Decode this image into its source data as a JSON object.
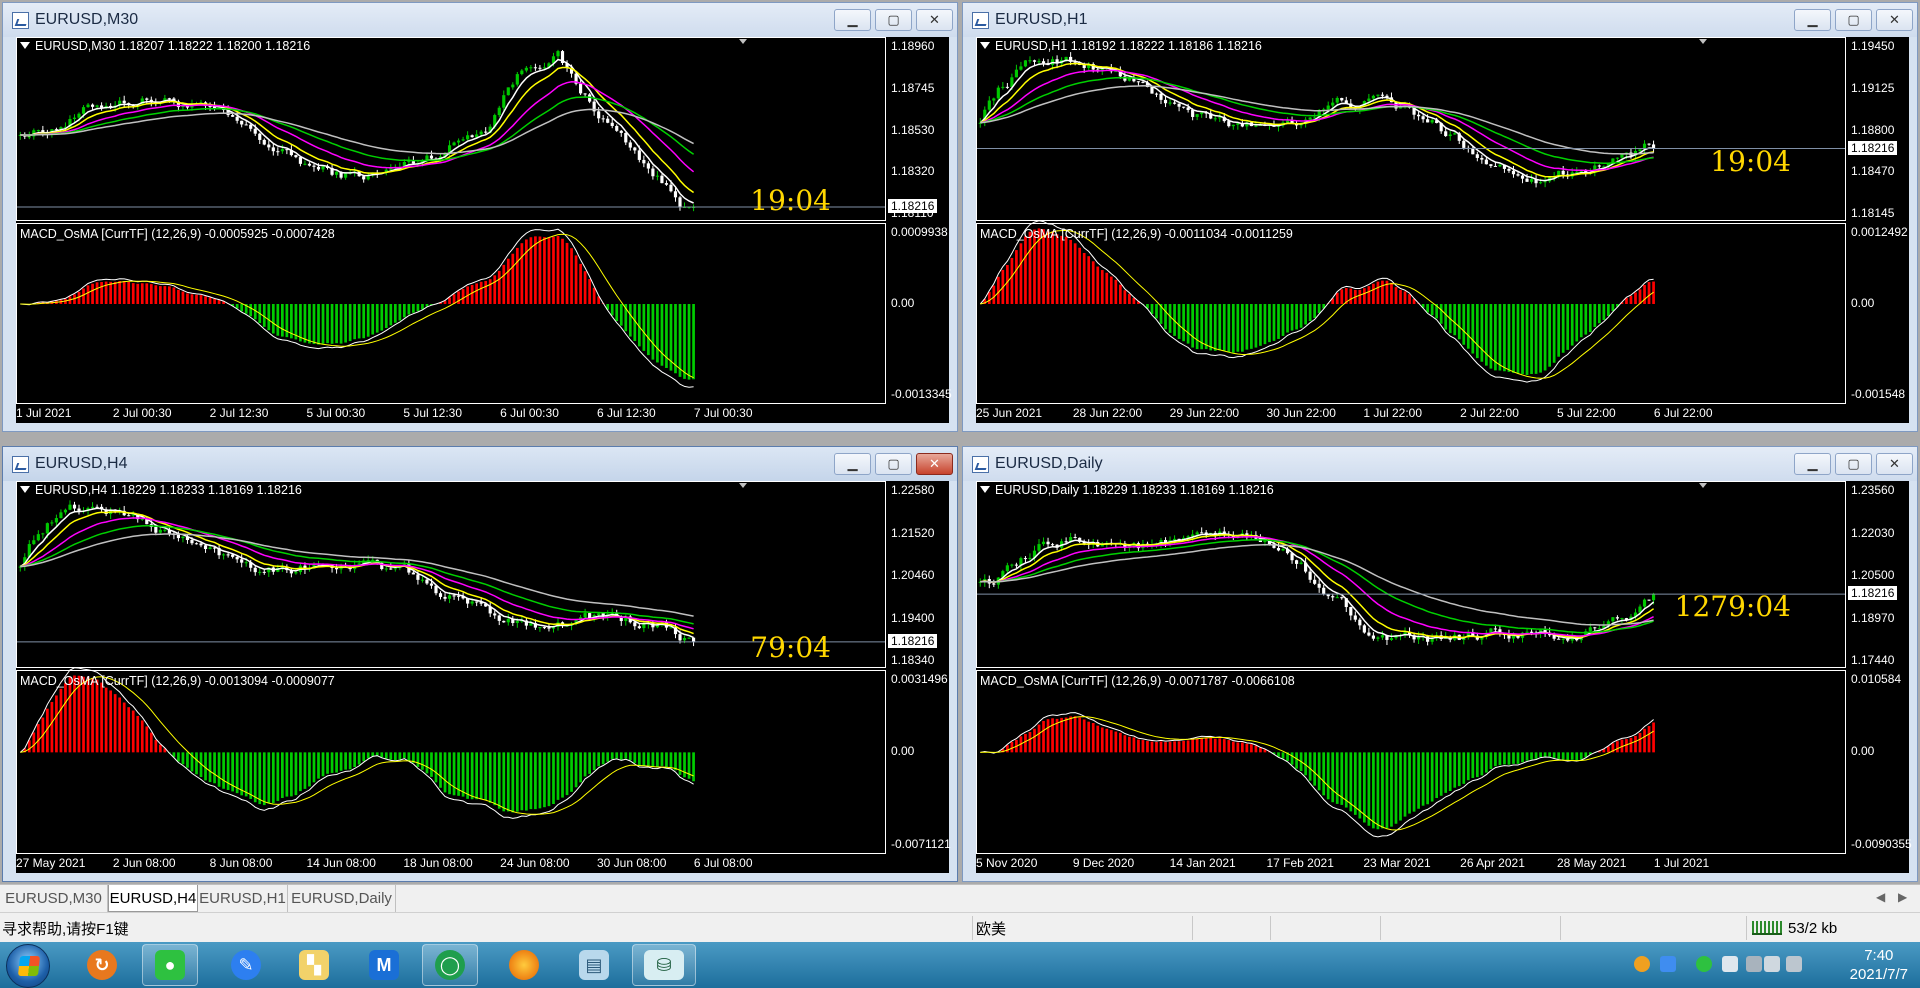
{
  "windows": [
    {
      "id": "m30",
      "title": "EURUSD,M30",
      "info": "EURUSD,M30  1.18207 1.18222 1.18200 1.18216",
      "prices": [
        "1.18960",
        "1.18745",
        "1.18530",
        "1.18320",
        "1.18110"
      ],
      "current_price": "1.18216",
      "timer": "19:04",
      "macd_info": "MACD_OsMA [CurrTF] (12,26,9) -0.0005925 -0.0007428",
      "macd_scale": [
        "0.0009938",
        "0.00",
        "-0.0013345"
      ],
      "dates": [
        "1 Jul 2021",
        "2 Jul 00:30",
        "2 Jul 12:30",
        "5 Jul 00:30",
        "5 Jul 12:30",
        "6 Jul 00:30",
        "6 Jul 12:30",
        "7 Jul 00:30"
      ]
    },
    {
      "id": "h1",
      "title": "EURUSD,H1",
      "info": "EURUSD,H1  1.18192 1.18222 1.18186 1.18216",
      "prices": [
        "1.19450",
        "1.19125",
        "1.18800",
        "1.18470",
        "1.18145"
      ],
      "current_price": "1.18216",
      "timer": "19:04",
      "macd_info": "MACD_OsMA [CurrTF] (12,26,9) -0.0011034 -0.0011259",
      "macd_scale": [
        "0.0012492",
        "0.00",
        "-0.001548"
      ],
      "dates": [
        "25 Jun 2021",
        "28 Jun 22:00",
        "29 Jun 22:00",
        "30 Jun 22:00",
        "1 Jul 22:00",
        "2 Jul 22:00",
        "5 Jul 22:00",
        "6 Jul 22:00"
      ]
    },
    {
      "id": "h4",
      "title": "EURUSD,H4",
      "info": "EURUSD,H4  1.18229 1.18233 1.18169 1.18216",
      "prices": [
        "1.22580",
        "1.21520",
        "1.20460",
        "1.19400",
        "1.18340"
      ],
      "current_price": "1.18216",
      "timer": "79:04",
      "macd_info": "MACD_OsMA [CurrTF] (12,26,9) -0.0013094 -0.0009077",
      "macd_scale": [
        "0.0031496",
        "0.00",
        "-0.0071121"
      ],
      "dates": [
        "27 May 2021",
        "2 Jun 08:00",
        "8 Jun 08:00",
        "14 Jun 08:00",
        "18 Jun 08:00",
        "24 Jun 08:00",
        "30 Jun 08:00",
        "6 Jul 08:00"
      ]
    },
    {
      "id": "d1",
      "title": "EURUSD,Daily",
      "info": "EURUSD,Daily  1.18229 1.18233 1.18169 1.18216",
      "prices": [
        "1.23560",
        "1.22030",
        "1.20500",
        "1.18970",
        "1.17440"
      ],
      "current_price": "1.18216",
      "timer": "1279:04",
      "macd_info": "MACD_OsMA [CurrTF] (12,26,9) -0.0071787 -0.0066108",
      "macd_scale": [
        "0.010584",
        "0.00",
        "-0.0090355"
      ],
      "dates": [
        "5 Nov 2020",
        "9 Dec 2020",
        "14 Jan 2021",
        "17 Feb 2021",
        "23 Mar 2021",
        "26 Apr 2021",
        "28 May 2021",
        "1 Jul 2021"
      ]
    }
  ],
  "tabs": [
    "EURUSD,M30",
    "EURUSD,H4",
    "EURUSD,H1",
    "EURUSD,Daily"
  ],
  "active_tab": "EURUSD,H4",
  "status": {
    "help": "寻求帮助,请按F1键",
    "profile": "欧美",
    "traffic": "53/2 kb"
  },
  "clock": {
    "time": "7:40",
    "date": "2021/7/7"
  },
  "colors": {
    "bull_candle": "#00c800",
    "bear_candle": "#ffffff",
    "ma_white": "#ffffff",
    "ma_yellow": "#ffff00",
    "ma_magenta": "#ff00ff",
    "ma_green": "#00d000",
    "ma_gray": "#c0c0c0",
    "hist_up": "#ff0000",
    "hist_down": "#00cc00",
    "timer": "#ffd700"
  },
  "icons": [
    "app-chart-icon",
    "minimize-icon",
    "maximize-icon",
    "close-icon",
    "start-orb-icon",
    "connection-bars-icon"
  ]
}
